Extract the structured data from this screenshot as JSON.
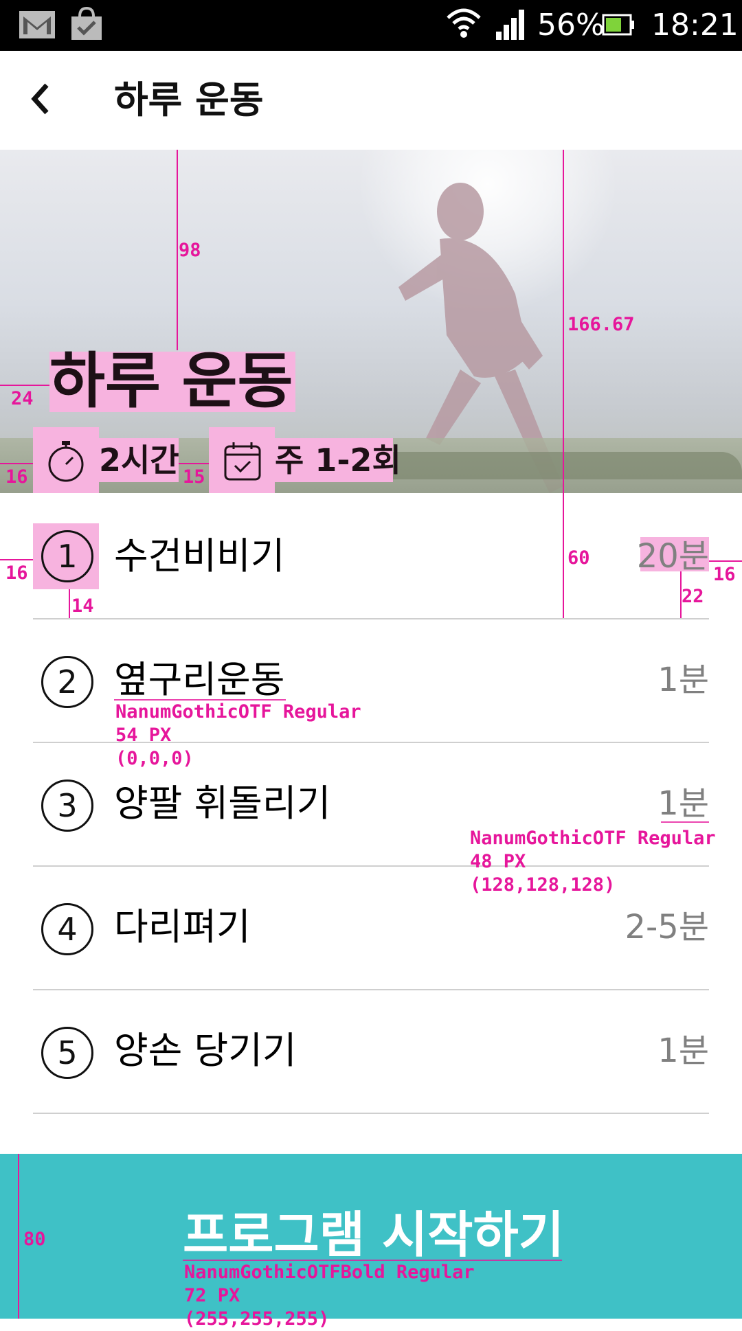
{
  "status_bar": {
    "battery_percent": "56%",
    "time": "18:21",
    "icons": [
      "gmail-icon",
      "store-bag-icon",
      "wifi-icon",
      "signal-icon",
      "battery-icon"
    ]
  },
  "app_bar": {
    "back_icon": "chevron-left-icon",
    "title": "하루 운동"
  },
  "hero": {
    "title": "하루 운동",
    "duration": "2시간",
    "frequency": "주 1-2회",
    "icons": [
      "stopwatch-icon",
      "calendar-check-icon"
    ]
  },
  "exercises": [
    {
      "number": "1",
      "name": "수건비비기",
      "duration": "20분"
    },
    {
      "number": "2",
      "name": "옆구리운동",
      "duration": "1분"
    },
    {
      "number": "3",
      "name": "양팔 휘돌리기",
      "duration": "1분"
    },
    {
      "number": "4",
      "name": "다리펴기",
      "duration": "2-5분"
    },
    {
      "number": "5",
      "name": "양손 당기기",
      "duration": "1분"
    }
  ],
  "cta": {
    "label": "프로그램 시작하기"
  },
  "spec_annotations": {
    "hero_top_gap": "98",
    "hero_left_gap": "24",
    "meta_left_gap": "16",
    "meta_gap": "15",
    "hero_height": "166.67",
    "row_height": "60",
    "row_left_gap": "16",
    "circle_bottom_gap": "14",
    "duration_bottom_gap": "22",
    "right_gap": "16",
    "cta_height": "80",
    "name_font": "NanumGothicOTF Regular\n54 PX\n(0,0,0)",
    "duration_font": "NanumGothicOTF Regular\n48 PX\n(128,128,128)",
    "cta_font": "NanumGothicOTFBold Regular\n72 PX\n(255,255,255)"
  },
  "colors": {
    "accent": "#3fc1c6",
    "spec": "#e6169b",
    "highlight": "#f7b3df",
    "muted_text": "#808080"
  }
}
